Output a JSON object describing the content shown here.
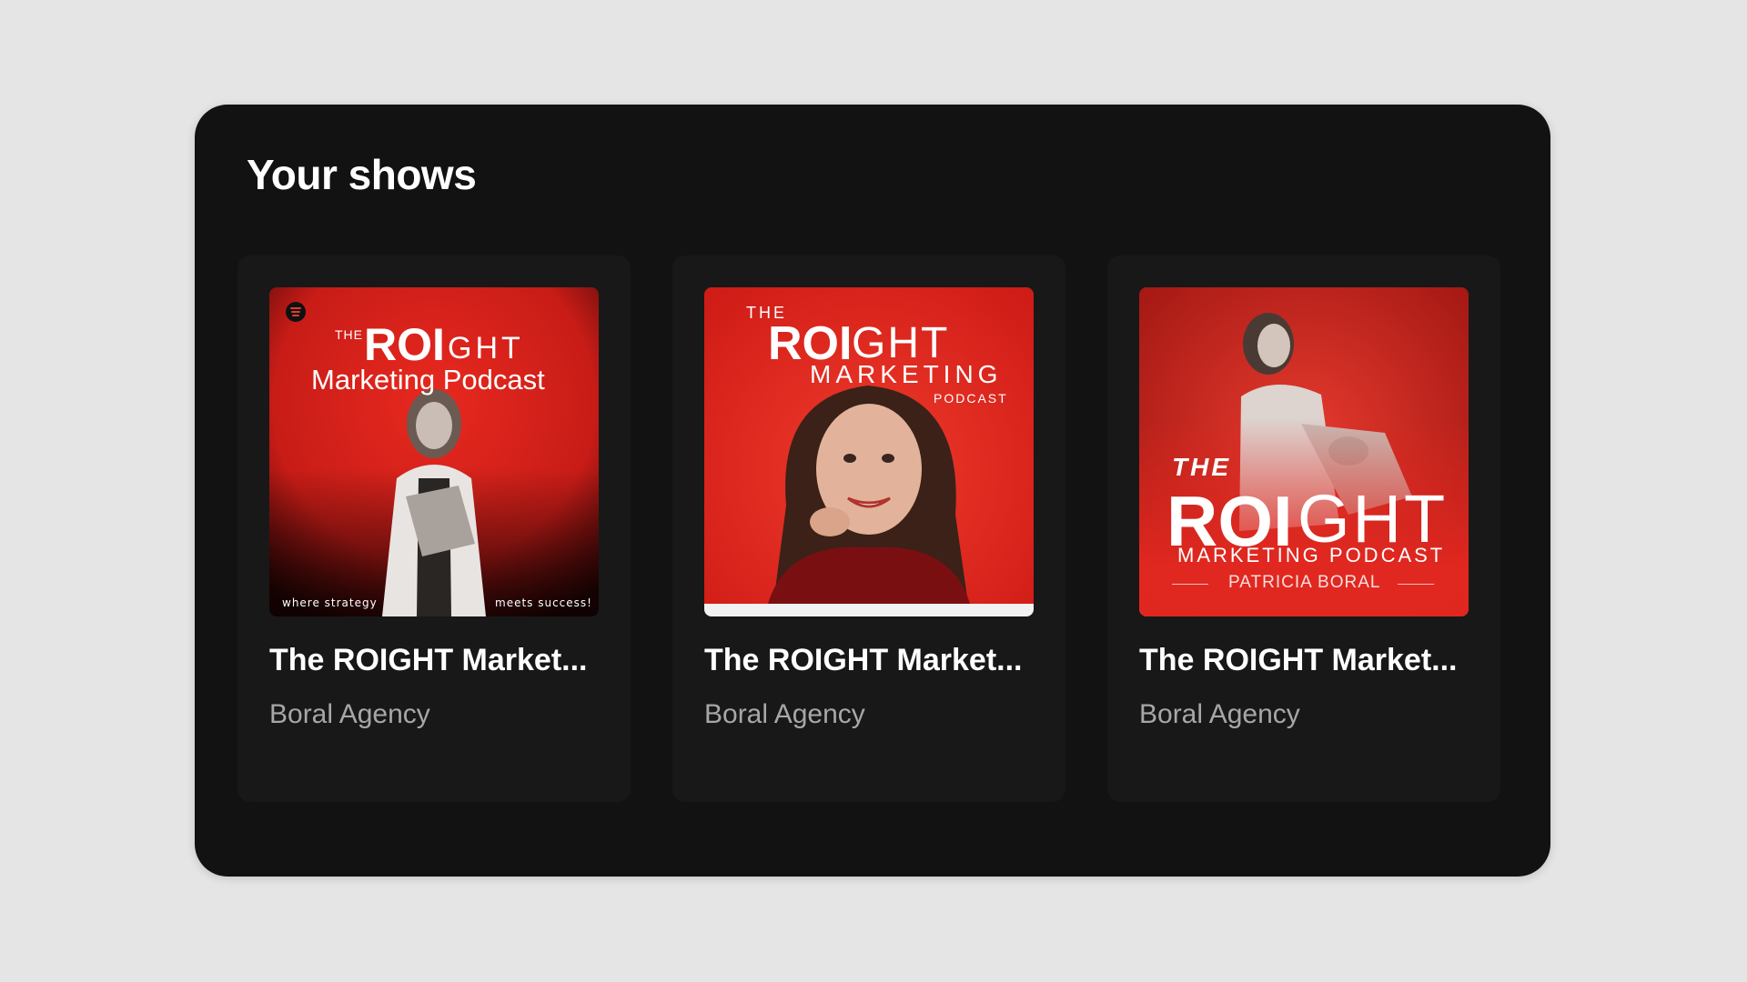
{
  "section": {
    "title": "Your shows"
  },
  "shows": [
    {
      "title": "The ROIGHT Market...",
      "publisher": "Boral Agency",
      "cover": {
        "the": "THE",
        "roi": "ROI",
        "ght": "GHT",
        "subtitle": "Marketing Podcast",
        "tagline_left": "where strategy",
        "tagline_right": "meets success!",
        "bg": "#d8231c"
      }
    },
    {
      "title": "The ROIGHT Market...",
      "publisher": "Boral Agency",
      "cover": {
        "the": "THE",
        "roi": "ROI",
        "ght": "GHT",
        "marketing": "MARKETING",
        "podcast": "PODCAST",
        "bg": "#e3261d"
      }
    },
    {
      "title": "The ROIGHT Market...",
      "publisher": "Boral Agency",
      "cover": {
        "the": "THE",
        "roi": "ROI",
        "ght": "GHT",
        "subtitle": "MARKETING PODCAST",
        "author": "PATRICIA BORAL",
        "bg": "#cf1f1c"
      }
    }
  ],
  "colors": {
    "page_bg": "#e5e5e5",
    "panel_bg": "#121212",
    "card_bg": "#181818",
    "title": "#ffffff",
    "subtitle": "#a7a7a7",
    "accent_red": "#e3261d"
  }
}
